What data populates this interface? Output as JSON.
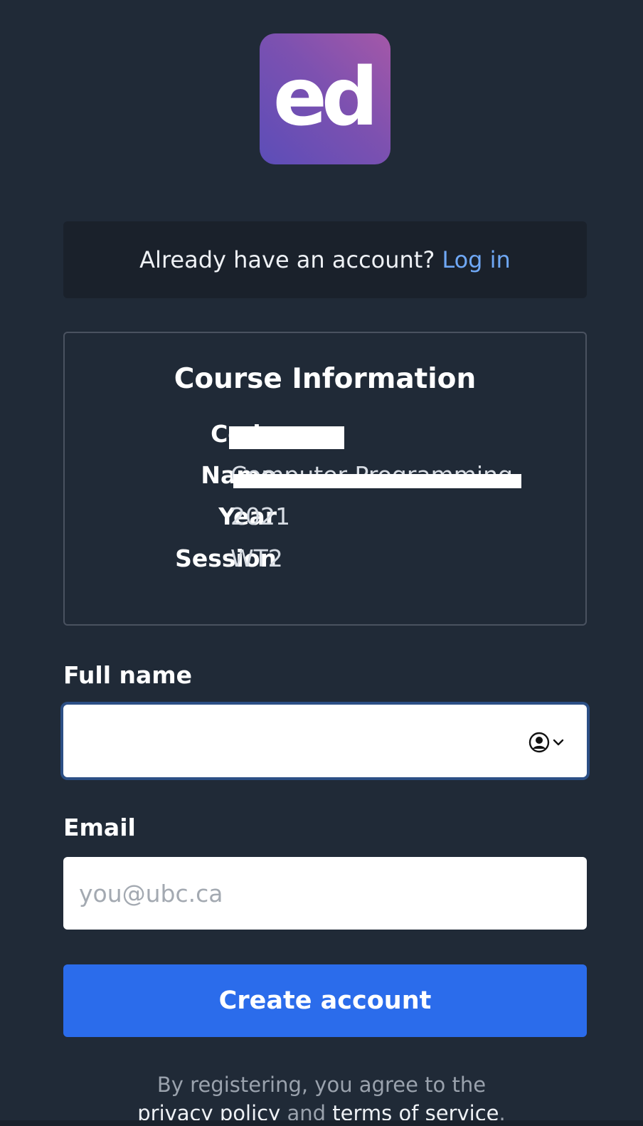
{
  "logo": {
    "text": "ed"
  },
  "login_banner": {
    "prompt": "Already have an account?",
    "link": "Log in"
  },
  "course_info": {
    "title": "Course Information",
    "rows": [
      {
        "label": "Code",
        "value": ""
      },
      {
        "label": "Name",
        "value": "Computer Programming 1"
      },
      {
        "label": "Year",
        "value": "2021"
      },
      {
        "label": "Session",
        "value": "WT2"
      }
    ]
  },
  "form": {
    "full_name": {
      "label": "Full name",
      "value": "",
      "placeholder": ""
    },
    "email": {
      "label": "Email",
      "value": "",
      "placeholder": "you@ubc.ca"
    },
    "submit_label": "Create account"
  },
  "terms": {
    "line1": "By registering, you agree to the",
    "privacy": "privacy policy",
    "and": "and",
    "tos": "terms of service",
    "end": "."
  },
  "colors": {
    "background": "#202a37",
    "link": "#6fa8f5",
    "primary_button": "#2b6ceb",
    "logo_gradient_start": "#5c4db8",
    "logo_gradient_end": "#a458a8"
  },
  "icons": {
    "autofill": "person-circle-icon",
    "chevron": "chevron-down-icon"
  }
}
